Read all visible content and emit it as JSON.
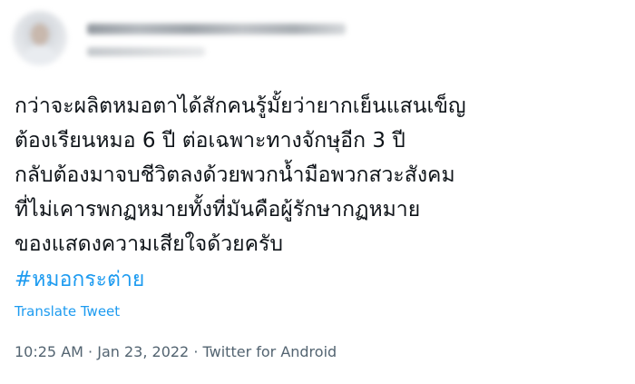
{
  "tweet": {
    "text": "กว่าจะผลิตหมอตาได้สักคนรู้มั้ยว่ายากเย็นแสนเข็ญ\nต้องเรียนหมอ 6 ปี ต่อเฉพาะทางจักษุอีก 3 ปี\nกลับต้องมาจบชีวิตลงด้วยพวกน้ำมือพวกสวะสังคม\nที่ไม่เคารพกฏหมายทั้งที่มันคือผู้รักษากฏหมาย\nของแสดงความเสียใจด้วยครับ",
    "hashtag": "#หมอกระต่าย",
    "translate_label": "Translate Tweet",
    "time": "10:25 AM",
    "date": "Jan 23, 2022",
    "source": "Twitter for Android",
    "separator": "·"
  }
}
